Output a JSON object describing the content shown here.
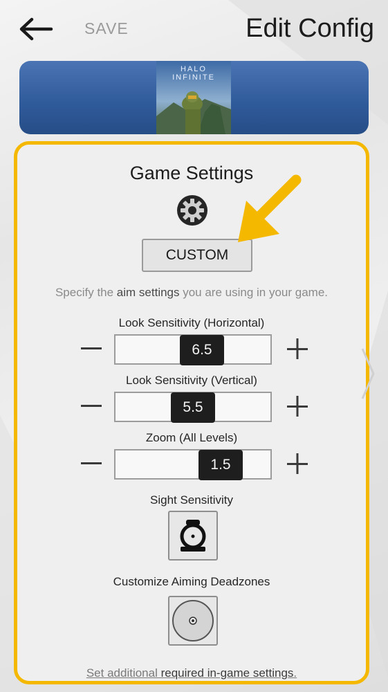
{
  "header": {
    "back_icon": "arrow-left-icon",
    "save_label": "SAVE",
    "title": "Edit Config"
  },
  "banner": {
    "game_logo_line1": "HALO",
    "game_logo_line2": "INFINITE"
  },
  "game_settings": {
    "title": "Game Settings",
    "gear_icon": "gear-icon",
    "mode_button": "CUSTOM",
    "hint_prefix": "Specify the ",
    "hint_bold": "aim settings",
    "hint_suffix": " you are using in your game.",
    "sliders": [
      {
        "label": "Look Sensitivity (Horizontal)",
        "value": "6.5",
        "fraction": 0.58
      },
      {
        "label": "Look Sensitivity (Vertical)",
        "value": "5.5",
        "fraction": 0.5
      },
      {
        "label": "Zoom (All Levels)",
        "value": "1.5",
        "fraction": 0.75
      }
    ],
    "sight_label": "Sight Sensitivity",
    "deadzone_label": "Customize Aiming Deadzones",
    "footer_prefix": "Set additional ",
    "footer_bold": "required in-game settings",
    "footer_suffix": "."
  },
  "colors": {
    "highlight": "#f5b800",
    "banner": "#2f5a9a",
    "thumb": "#1e1e1e"
  }
}
